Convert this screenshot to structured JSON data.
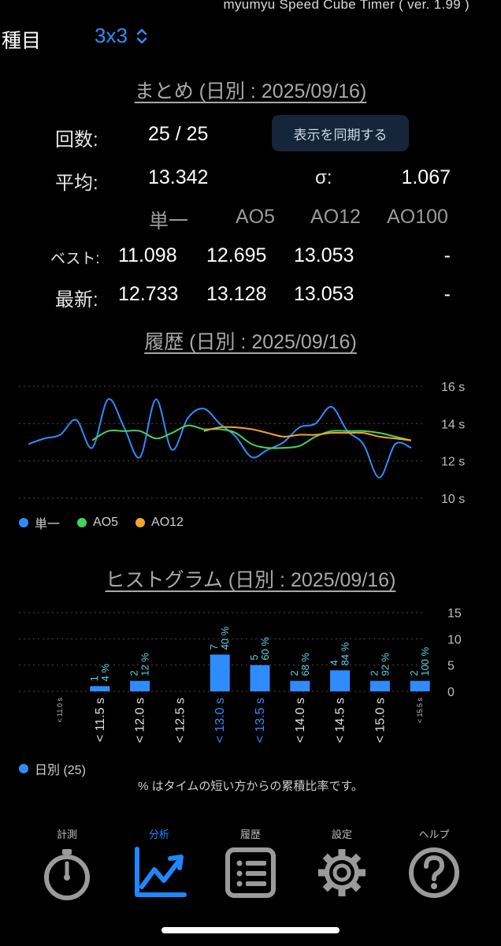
{
  "app": {
    "version_text": "myumyu Speed Cube Timer ( ver. 1.99 )"
  },
  "event": {
    "label": "種目",
    "value": "3x3"
  },
  "summary": {
    "title": "まとめ (日別 : 2025/09/16)",
    "count_label": "回数:",
    "count_value": "25 / 25",
    "sync_button": "表示を同期する",
    "mean_label": "平均:",
    "mean_value": "13.342",
    "sigma_label": "σ:",
    "sigma_value": "1.067",
    "headers": [
      "単一",
      "AO5",
      "AO12",
      "AO100"
    ],
    "best_label": "ベスト:",
    "best": [
      "11.098",
      "12.695",
      "13.053",
      "-"
    ],
    "latest_label": "最新:",
    "latest": [
      "12.733",
      "13.128",
      "13.053",
      "-"
    ]
  },
  "history": {
    "title": "履歴 (日別 : 2025/09/16)",
    "legend": [
      "単一",
      "AO5",
      "AO12"
    ]
  },
  "histogram": {
    "title": "ヒストグラム (日別 : 2025/09/16)",
    "legend": "日別 (25)",
    "note": "% はタイムの短い方からの累積比率です。"
  },
  "tabs": [
    {
      "label": "計測",
      "icon": "stopwatch-icon"
    },
    {
      "label": "分析",
      "icon": "chart-icon"
    },
    {
      "label": "履歴",
      "icon": "list-icon"
    },
    {
      "label": "設定",
      "icon": "gear-icon"
    },
    {
      "label": "ヘルプ",
      "icon": "help-icon"
    }
  ],
  "colors": {
    "accent": "#1f87ff",
    "single": "#2f8cff",
    "ao5": "#46d35a",
    "ao12": "#f5a623",
    "histogram_label": "#5fd0e0"
  },
  "chart_data": [
    {
      "type": "line",
      "title": "履歴 (日別 : 2025/09/16)",
      "x": [
        1,
        2,
        3,
        4,
        5,
        6,
        7,
        8,
        9,
        10,
        11,
        12,
        13,
        14,
        15,
        16,
        17,
        18,
        19,
        20,
        21,
        22,
        23,
        24,
        25
      ],
      "ylim": [
        10,
        16
      ],
      "yticks": [
        "10 s",
        "12 s",
        "14 s",
        "16 s"
      ],
      "legend_position": "bottom-left",
      "series": [
        {
          "name": "単一",
          "values": [
            12.9,
            13.2,
            13.4,
            14.2,
            12.7,
            15.3,
            13.8,
            12.2,
            15.3,
            12.6,
            14.3,
            14.8,
            14.0,
            13.3,
            12.2,
            12.6,
            13.0,
            13.8,
            14.0,
            14.9,
            13.6,
            12.9,
            11.1,
            12.9,
            12.7
          ]
        },
        {
          "name": "AO5",
          "values": [
            null,
            null,
            null,
            null,
            13.1,
            13.6,
            13.6,
            13.6,
            13.2,
            13.5,
            13.9,
            13.7,
            13.7,
            13.5,
            12.9,
            12.7,
            12.7,
            12.8,
            13.3,
            13.6,
            13.6,
            13.6,
            13.5,
            13.3,
            13.1
          ]
        },
        {
          "name": "AO12",
          "values": [
            null,
            null,
            null,
            null,
            null,
            null,
            null,
            null,
            null,
            null,
            null,
            13.6,
            13.8,
            13.8,
            13.7,
            13.5,
            13.3,
            13.4,
            13.4,
            13.5,
            13.5,
            13.5,
            13.3,
            13.2,
            13.1
          ]
        }
      ],
      "grid": true
    },
    {
      "type": "bar",
      "title": "ヒストグラム (日別 : 2025/09/16)",
      "categories": [
        "< 11.0 s",
        "< 11.5 s",
        "< 12.0 s",
        "< 12.5 s",
        "< 13.0 s",
        "< 13.5 s",
        "< 14.0 s",
        "< 14.5 s",
        "< 15.0 s",
        "< 15.5 s"
      ],
      "series": [
        {
          "name": "日別 (25)",
          "values": [
            0,
            1,
            2,
            0,
            7,
            5,
            2,
            4,
            2,
            2
          ]
        }
      ],
      "counts": [
        "",
        "1",
        "2",
        "",
        "7",
        "5",
        "2",
        "4",
        "2",
        "2"
      ],
      "percents": [
        "",
        "4 %",
        "12 %",
        "",
        "40 %",
        "60 %",
        "68 %",
        "84 %",
        "92 %",
        "100 %"
      ],
      "highlight_categories": [
        "< 13.0 s",
        "< 13.5 s"
      ],
      "ylim": [
        0,
        15
      ],
      "yticks": [
        "0",
        "5",
        "10",
        "15"
      ],
      "grid": true
    }
  ]
}
